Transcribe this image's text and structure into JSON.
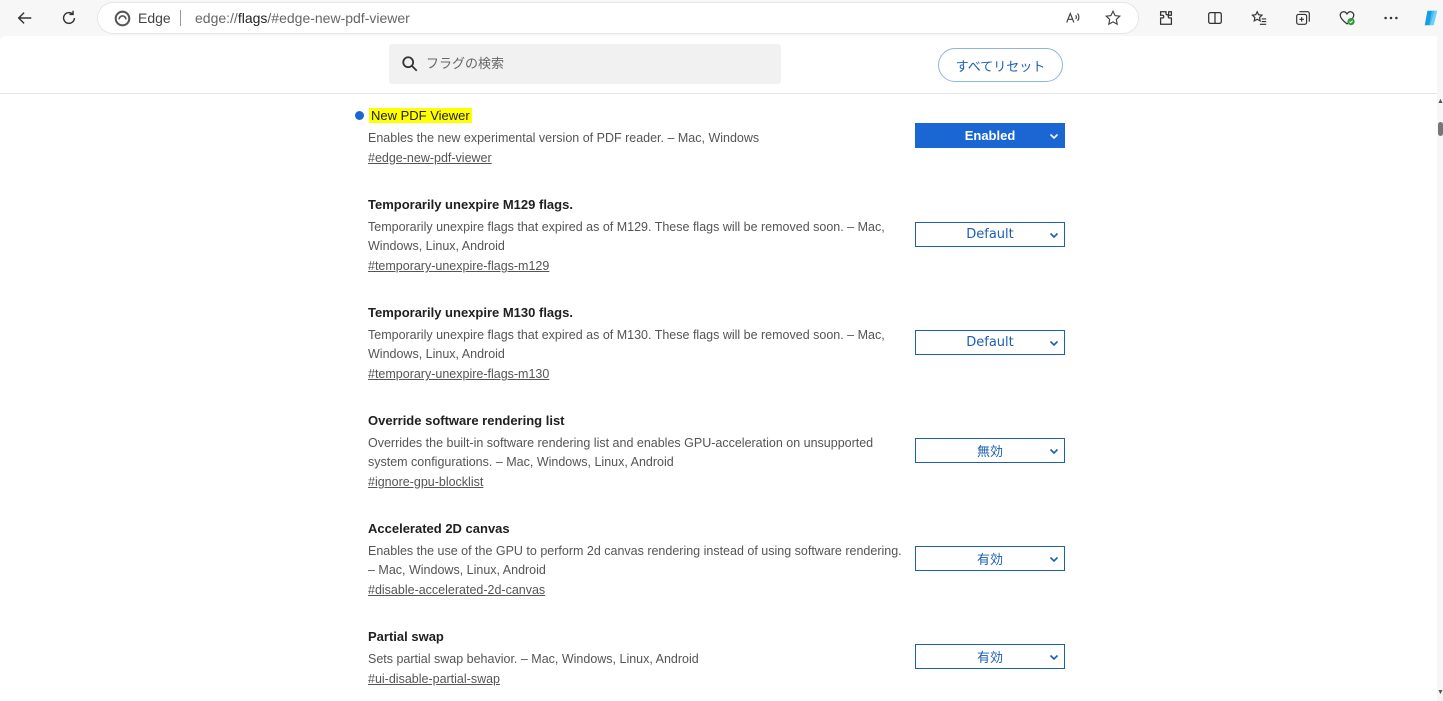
{
  "browser": {
    "site_label": "Edge",
    "url_prefix": "edge://",
    "url_bold": "flags",
    "url_suffix": "/#edge-new-pdf-viewer"
  },
  "header": {
    "search_placeholder": "フラグの検索",
    "reset_label": "すべてリセット"
  },
  "flags": [
    {
      "title": "New PDF Viewer",
      "description": "Enables the new experimental version of PDF reader. – Mac, Windows",
      "link": "#edge-new-pdf-viewer",
      "value": "Enabled"
    },
    {
      "title": "Temporarily unexpire M129 flags.",
      "description": "Temporarily unexpire flags that expired as of M129. These flags will be removed soon. – Mac, Windows, Linux, Android",
      "link": "#temporary-unexpire-flags-m129",
      "value": "Default"
    },
    {
      "title": "Temporarily unexpire M130 flags.",
      "description": "Temporarily unexpire flags that expired as of M130. These flags will be removed soon. – Mac, Windows, Linux, Android",
      "link": "#temporary-unexpire-flags-m130",
      "value": "Default"
    },
    {
      "title": "Override software rendering list",
      "description": "Overrides the built-in software rendering list and enables GPU-acceleration on unsupported system configurations. – Mac, Windows, Linux, Android",
      "link": "#ignore-gpu-blocklist",
      "value": "無効"
    },
    {
      "title": "Accelerated 2D canvas",
      "description": "Enables the use of the GPU to perform 2d canvas rendering instead of using software rendering. – Mac, Windows, Linux, Android",
      "link": "#disable-accelerated-2d-canvas",
      "value": "有効"
    },
    {
      "title": "Partial swap",
      "description": "Sets partial swap behavior. – Mac, Windows, Linux, Android",
      "link": "#ui-disable-partial-swap",
      "value": "有効"
    }
  ],
  "colors": {
    "accent": "#1a66d2",
    "highlight": "#ffff00"
  }
}
